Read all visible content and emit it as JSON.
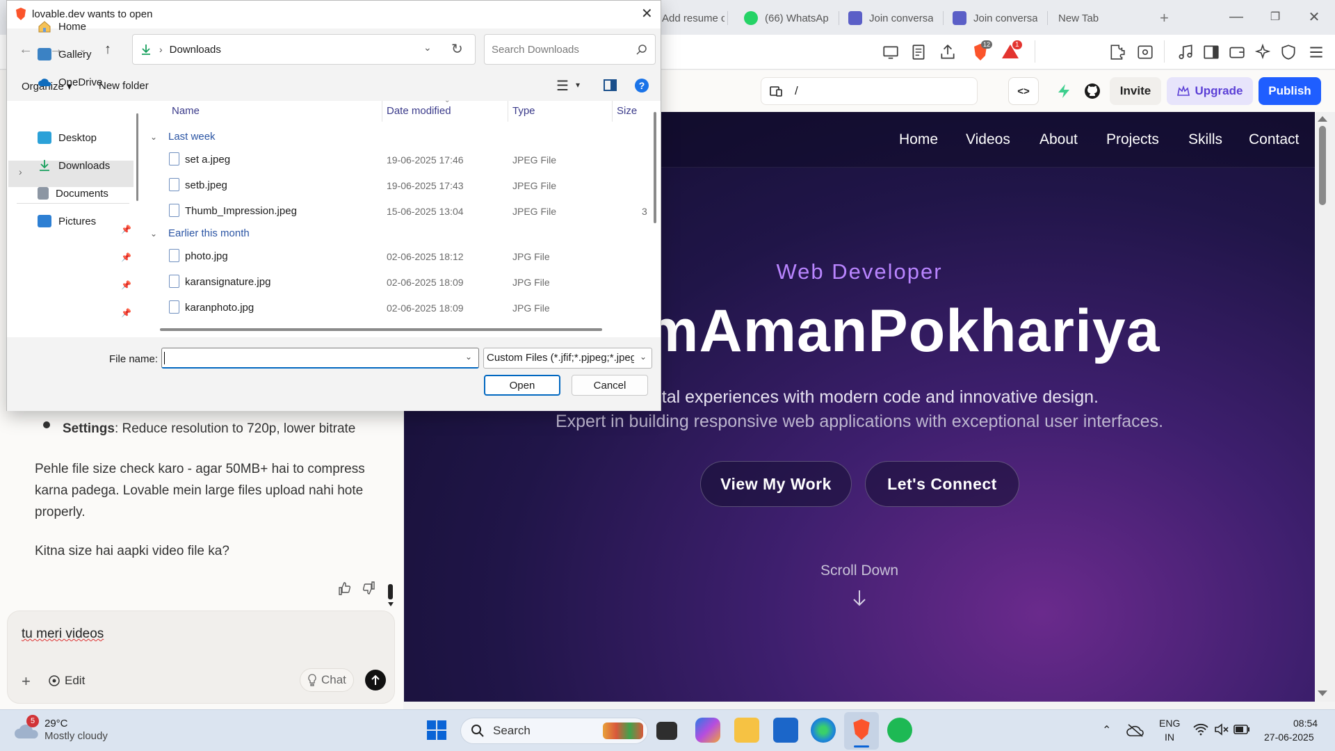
{
  "browser": {
    "tabs": [
      {
        "label": "Add resume c",
        "icon": "lovable-icon"
      },
      {
        "label": "(66) WhatsAp",
        "icon": "whatsapp-icon"
      },
      {
        "label": "Join conversa",
        "icon": "teams-icon"
      },
      {
        "label": "Join conversa",
        "icon": "teams-icon"
      },
      {
        "label": "New Tab",
        "icon": ""
      }
    ],
    "new_tab": "+",
    "shield_badge": "12",
    "alert_badge": "1"
  },
  "lovable": {
    "path": "/",
    "invite": "Invite",
    "upgrade": "Upgrade",
    "publish": "Publish",
    "code_toggle": "<>"
  },
  "chat": {
    "bullet_label": "Settings",
    "bullet_text": ": Reduce resolution to 720p, lower bitrate",
    "para1": "Pehle file size check karo - agar 50MB+ hai to compress karna padega. Lovable mein large files upload nahi hote properly.",
    "para2": "Kitna size hai aapki video file ka?",
    "input_value": "tu meri videos",
    "edit_label": "Edit",
    "chat_label": "Chat"
  },
  "preview": {
    "nav": [
      "Home",
      "Videos",
      "About",
      "Projects",
      "Skills",
      "Contact"
    ],
    "eyebrow": "Web Developer",
    "name": "mAmanPokhariya",
    "tagline1": "g digital experiences with modern code and innovative design.",
    "tagline2": "Expert in building responsive web applications with exceptional user interfaces.",
    "btn_work": "View My Work",
    "btn_connect": "Let's Connect",
    "scroll": "Scroll Down"
  },
  "dialog": {
    "title": "lovable.dev wants to open",
    "location": "Downloads",
    "search_placeholder": "Search Downloads",
    "organize": "Organize",
    "new_folder": "New folder",
    "sidebar": [
      {
        "label": "Home",
        "icon": "home-icon",
        "pinned": false
      },
      {
        "label": "Gallery",
        "icon": "gallery-icon",
        "pinned": false
      },
      {
        "label": "OneDrive",
        "icon": "onedrive-icon",
        "pinned": false,
        "selected": true
      },
      {
        "label": "Desktop",
        "icon": "desktop-icon",
        "pinned": true
      },
      {
        "label": "Downloads",
        "icon": "download-icon",
        "pinned": true
      },
      {
        "label": "Documents",
        "icon": "documents-icon",
        "pinned": true
      },
      {
        "label": "Pictures",
        "icon": "pictures-icon",
        "pinned": true
      }
    ],
    "columns": [
      "Name",
      "Date modified",
      "Type",
      "Size"
    ],
    "groups": [
      {
        "label": "Last week",
        "files": [
          {
            "name": "set a.jpeg",
            "date": "19-06-2025 17:46",
            "type": "JPEG File",
            "size": ""
          },
          {
            "name": "setb.jpeg",
            "date": "19-06-2025 17:43",
            "type": "JPEG File",
            "size": ""
          },
          {
            "name": "Thumb_Impression.jpeg",
            "date": "15-06-2025 13:04",
            "type": "JPEG File",
            "size": "3"
          }
        ]
      },
      {
        "label": "Earlier this month",
        "files": [
          {
            "name": "photo.jpg",
            "date": "02-06-2025 18:12",
            "type": "JPG File",
            "size": ""
          },
          {
            "name": "karansignature.jpg",
            "date": "02-06-2025 18:09",
            "type": "JPG File",
            "size": ""
          },
          {
            "name": "karanphoto.jpg",
            "date": "02-06-2025 18:09",
            "type": "JPG File",
            "size": ""
          }
        ]
      }
    ],
    "file_name_label": "File name:",
    "file_name_value": "",
    "filter": "Custom Files (*.jfif;*.pjpeg;*.jpeg",
    "open": "Open",
    "cancel": "Cancel"
  },
  "taskbar": {
    "weather_temp": "29°C",
    "weather_desc": "Mostly cloudy",
    "weather_badge": "5",
    "search": "Search",
    "lang1": "ENG",
    "lang2": "IN",
    "time": "08:54",
    "date": "27-06-2025"
  },
  "colors": {
    "publish": "#1f5eff",
    "upgrade_bg": "#e7e4fb",
    "eyebrow": "#b985ff",
    "dialog_link": "#2b55a4"
  }
}
